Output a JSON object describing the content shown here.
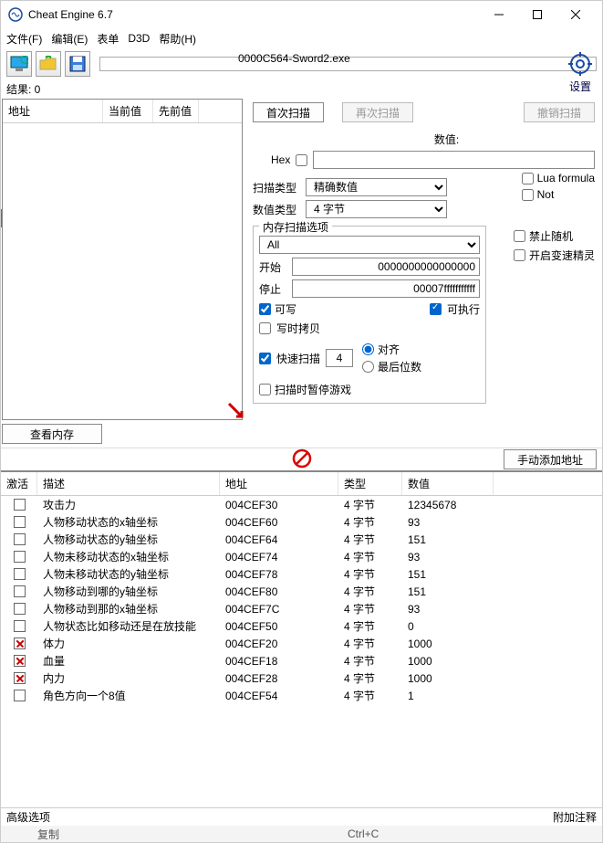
{
  "window": {
    "title": "Cheat Engine 6.7"
  },
  "menu": {
    "file": "文件(F)",
    "edit": "编辑(E)",
    "table": "表单",
    "d3d": "D3D",
    "help": "帮助(H)"
  },
  "target_process": "0000C564-Sword2.exe",
  "settings_label": "设置",
  "results_label": "结果: 0",
  "addr_list": {
    "col_addr": "地址",
    "col_current": "当前值",
    "col_previous": "先前值"
  },
  "memory_view_button": "查看内存",
  "scan": {
    "first_scan": "首次扫描",
    "next_scan": "再次扫描",
    "undo_scan": "撤销扫描",
    "value_label": "数值:",
    "hex_label": "Hex",
    "value_input": "",
    "scan_type_label": "扫描类型",
    "scan_type_selected": "精确数值",
    "value_type_label": "数值类型",
    "value_type_selected": "4 字节",
    "lua_formula": "Lua formula",
    "not": "Not"
  },
  "mem_opts": {
    "legend": "内存扫描选项",
    "preset": "All",
    "start_label": "开始",
    "start_value": "0000000000000000",
    "stop_label": "停止",
    "stop_value": "00007fffffffffff",
    "writable": "可写",
    "executable": "可执行",
    "copy_on_write": "写时拷贝",
    "fast_scan": "快速扫描",
    "fast_scan_value": "4",
    "aligned": "对齐",
    "last_digits": "最后位数",
    "pause_while_scan": "扫描时暂停游戏",
    "no_random": "禁止随机",
    "enable_speedhack": "开启变速精灵"
  },
  "midbar": {
    "manual_add": "手动添加地址"
  },
  "table": {
    "headers": {
      "active": "激活",
      "desc": "描述",
      "addr": "地址",
      "type": "类型",
      "value": "数值"
    },
    "rows": [
      {
        "active": false,
        "desc": "攻击力",
        "addr": "004CEF30",
        "type": "4 字节",
        "value": "12345678"
      },
      {
        "active": false,
        "desc": "人物移动状态的x轴坐标",
        "addr": "004CEF60",
        "type": "4 字节",
        "value": "93"
      },
      {
        "active": false,
        "desc": "人物移动状态的y轴坐标",
        "addr": "004CEF64",
        "type": "4 字节",
        "value": "151"
      },
      {
        "active": false,
        "desc": "人物未移动状态的x轴坐标",
        "addr": "004CEF74",
        "type": "4 字节",
        "value": "93"
      },
      {
        "active": false,
        "desc": "人物未移动状态的y轴坐标",
        "addr": "004CEF78",
        "type": "4 字节",
        "value": "151"
      },
      {
        "active": false,
        "desc": "人物移动到哪的y轴坐标",
        "addr": "004CEF80",
        "type": "4 字节",
        "value": "151"
      },
      {
        "active": false,
        "desc": "人物移动到那的x轴坐标",
        "addr": "004CEF7C",
        "type": "4 字节",
        "value": "93"
      },
      {
        "active": false,
        "desc": "人物状态比如移动还是在放技能",
        "addr": "004CEF50",
        "type": "4 字节",
        "value": "0"
      },
      {
        "active": true,
        "desc": "体力",
        "addr": "004CEF20",
        "type": "4 字节",
        "value": "1000"
      },
      {
        "active": true,
        "desc": "血量",
        "addr": "004CEF18",
        "type": "4 字节",
        "value": "1000"
      },
      {
        "active": true,
        "desc": "内力",
        "addr": "004CEF28",
        "type": "4 字节",
        "value": "1000"
      },
      {
        "active": false,
        "desc": "角色方向一个8值",
        "addr": "004CEF54",
        "type": "4 字节",
        "value": "1"
      }
    ]
  },
  "bottom": {
    "adv_opts": "高级选项",
    "add_comment": "附加注释"
  },
  "context": {
    "copy": "复制",
    "shortcut": "Ctrl+C"
  }
}
